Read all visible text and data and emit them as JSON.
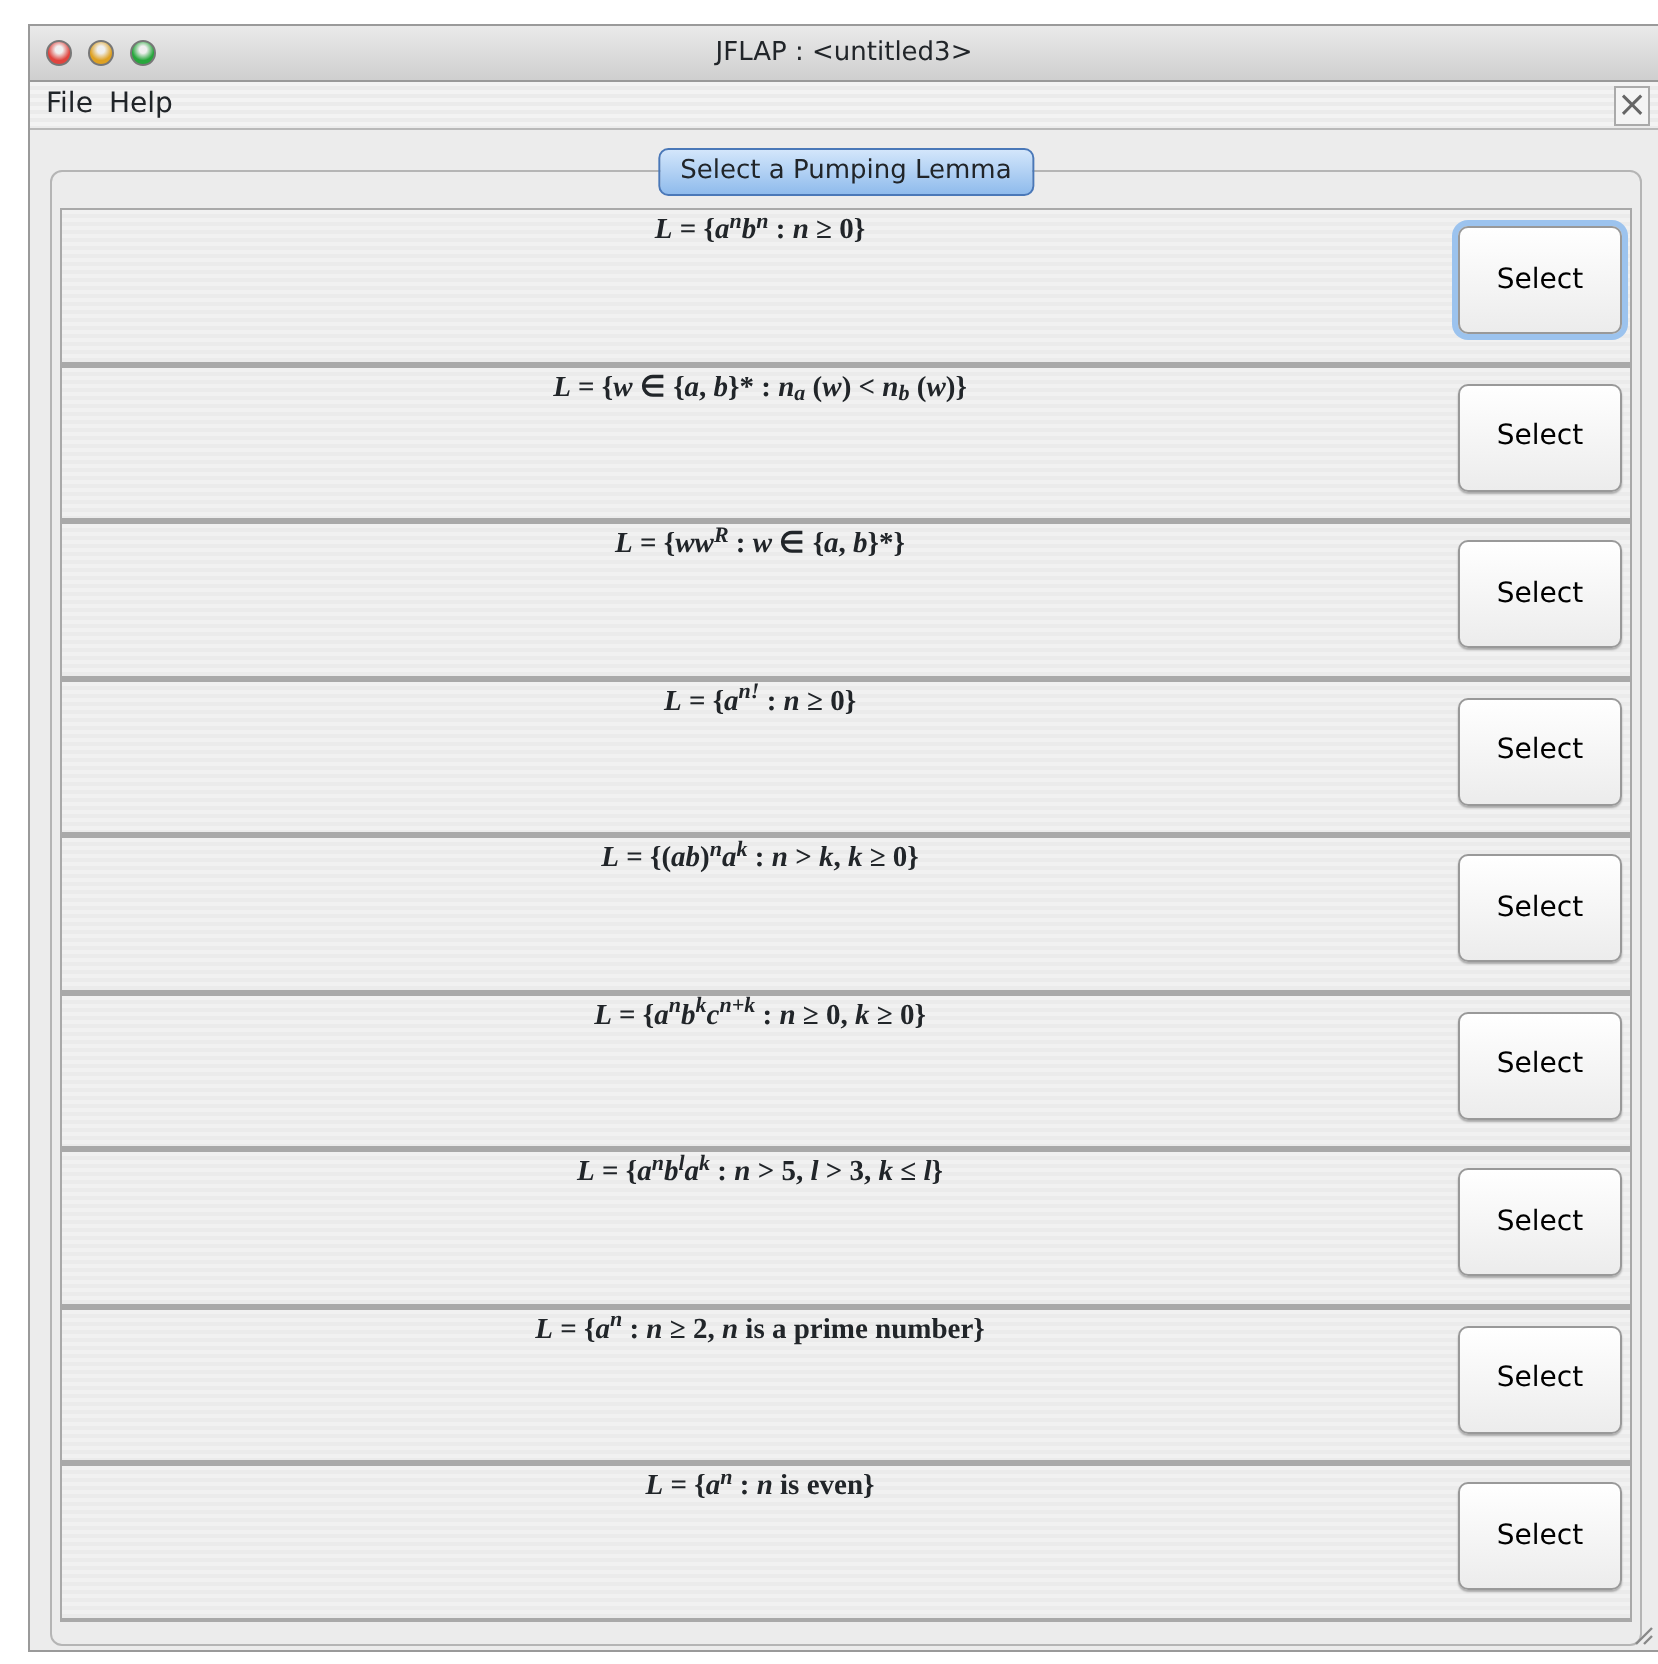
{
  "window": {
    "title": "JFLAP : <untitled3>"
  },
  "menu": [
    "File",
    "Help"
  ],
  "close_symbol": "×",
  "panel_title": "Select a Pumping Lemma",
  "lemmas": [
    {
      "formula": "*L* = {*a*$^{n}$*b*$^{n}$ : *n* ≥ 0}",
      "button": "Select",
      "focused": true
    },
    {
      "formula": "*L* = {*w* ∈ {*a*, *b*}* : *n*$_{a}$ (*w*) < *n*$_{b}$ (*w*)}",
      "button": "Select",
      "focused": false
    },
    {
      "formula": "*L* = {*ww*$^{R}$ : *w* ∈ {*a*, *b*}*}",
      "button": "Select",
      "focused": false
    },
    {
      "formula": "*L* = {*a*$^{n!}$ : *n* ≥ 0}",
      "button": "Select",
      "focused": false
    },
    {
      "formula": "*L* = {(*ab*)$^{n}$*a*$^{k}$ : *n* > *k*, *k* ≥ 0}",
      "button": "Select",
      "focused": false
    },
    {
      "formula": "*L* = {*a*$^{n}$*b*$^{k}$*c*$^{n+k}$ : *n* ≥ 0, *k* ≥ 0}",
      "button": "Select",
      "focused": false
    },
    {
      "formula": "*L* = {*a*$^{n}$*b*$^{l}$*a*$^{k}$ : *n* > 5, *l* > 3, *k* ≤ *l*}",
      "button": "Select",
      "focused": false
    },
    {
      "formula": "*L* = {*a*$^{n}$ : *n* ≥ 2, *n* is a prime number}",
      "button": "Select",
      "focused": false
    },
    {
      "formula": "*L* = {*a*$^{n}$ : *n* is even}",
      "button": "Select",
      "focused": false
    }
  ]
}
